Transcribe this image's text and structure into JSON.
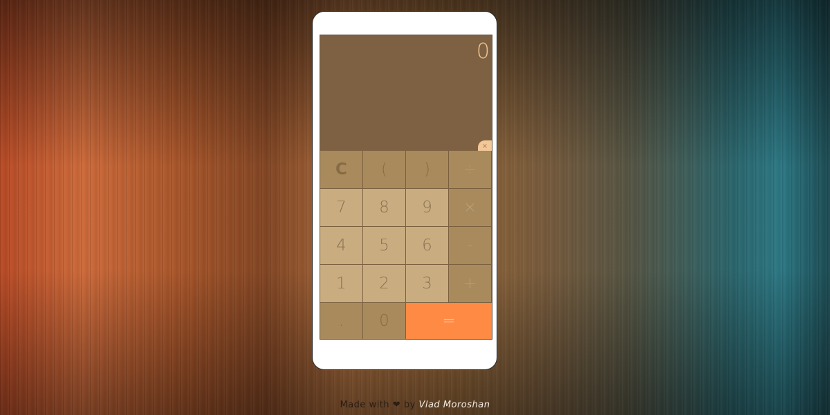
{
  "display": {
    "value": "0",
    "mini_clear": "×"
  },
  "keys": {
    "row1": [
      "C",
      "(",
      ")",
      "÷"
    ],
    "row2": [
      "7",
      "8",
      "9",
      "×"
    ],
    "row3": [
      "4",
      "5",
      "6",
      "-"
    ],
    "row4": [
      "1",
      "2",
      "3",
      "+"
    ],
    "row5": [
      ".",
      "0",
      "="
    ]
  },
  "footer": {
    "made_with": "Made with",
    "heart": "❤",
    "by": "by",
    "author": "Vlad Moroshan"
  },
  "colors": {
    "display": "#7d6142",
    "number_key": "#c9ad80",
    "function_key": "#a88a5c",
    "equals_key": "#ff8a44",
    "display_text": "#f0c792"
  }
}
